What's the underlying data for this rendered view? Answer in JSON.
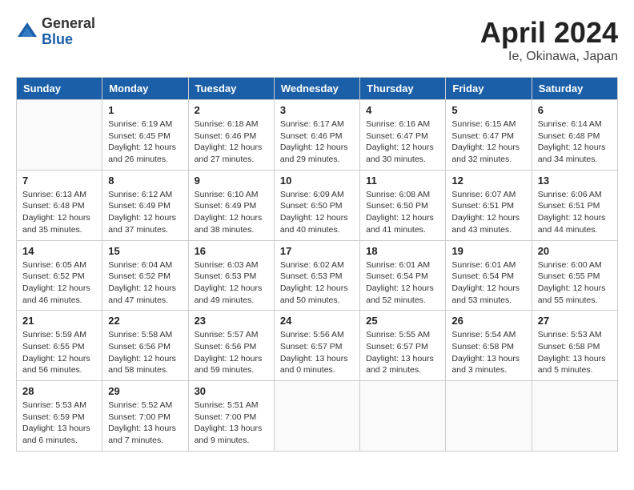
{
  "logo": {
    "general": "General",
    "blue": "Blue"
  },
  "title": "April 2024",
  "location": "Ie, Okinawa, Japan",
  "headers": [
    "Sunday",
    "Monday",
    "Tuesday",
    "Wednesday",
    "Thursday",
    "Friday",
    "Saturday"
  ],
  "weeks": [
    [
      {
        "day": "",
        "info": ""
      },
      {
        "day": "1",
        "info": "Sunrise: 6:19 AM\nSunset: 6:45 PM\nDaylight: 12 hours\nand 26 minutes."
      },
      {
        "day": "2",
        "info": "Sunrise: 6:18 AM\nSunset: 6:46 PM\nDaylight: 12 hours\nand 27 minutes."
      },
      {
        "day": "3",
        "info": "Sunrise: 6:17 AM\nSunset: 6:46 PM\nDaylight: 12 hours\nand 29 minutes."
      },
      {
        "day": "4",
        "info": "Sunrise: 6:16 AM\nSunset: 6:47 PM\nDaylight: 12 hours\nand 30 minutes."
      },
      {
        "day": "5",
        "info": "Sunrise: 6:15 AM\nSunset: 6:47 PM\nDaylight: 12 hours\nand 32 minutes."
      },
      {
        "day": "6",
        "info": "Sunrise: 6:14 AM\nSunset: 6:48 PM\nDaylight: 12 hours\nand 34 minutes."
      }
    ],
    [
      {
        "day": "7",
        "info": "Sunrise: 6:13 AM\nSunset: 6:48 PM\nDaylight: 12 hours\nand 35 minutes."
      },
      {
        "day": "8",
        "info": "Sunrise: 6:12 AM\nSunset: 6:49 PM\nDaylight: 12 hours\nand 37 minutes."
      },
      {
        "day": "9",
        "info": "Sunrise: 6:10 AM\nSunset: 6:49 PM\nDaylight: 12 hours\nand 38 minutes."
      },
      {
        "day": "10",
        "info": "Sunrise: 6:09 AM\nSunset: 6:50 PM\nDaylight: 12 hours\nand 40 minutes."
      },
      {
        "day": "11",
        "info": "Sunrise: 6:08 AM\nSunset: 6:50 PM\nDaylight: 12 hours\nand 41 minutes."
      },
      {
        "day": "12",
        "info": "Sunrise: 6:07 AM\nSunset: 6:51 PM\nDaylight: 12 hours\nand 43 minutes."
      },
      {
        "day": "13",
        "info": "Sunrise: 6:06 AM\nSunset: 6:51 PM\nDaylight: 12 hours\nand 44 minutes."
      }
    ],
    [
      {
        "day": "14",
        "info": "Sunrise: 6:05 AM\nSunset: 6:52 PM\nDaylight: 12 hours\nand 46 minutes."
      },
      {
        "day": "15",
        "info": "Sunrise: 6:04 AM\nSunset: 6:52 PM\nDaylight: 12 hours\nand 47 minutes."
      },
      {
        "day": "16",
        "info": "Sunrise: 6:03 AM\nSunset: 6:53 PM\nDaylight: 12 hours\nand 49 minutes."
      },
      {
        "day": "17",
        "info": "Sunrise: 6:02 AM\nSunset: 6:53 PM\nDaylight: 12 hours\nand 50 minutes."
      },
      {
        "day": "18",
        "info": "Sunrise: 6:01 AM\nSunset: 6:54 PM\nDaylight: 12 hours\nand 52 minutes."
      },
      {
        "day": "19",
        "info": "Sunrise: 6:01 AM\nSunset: 6:54 PM\nDaylight: 12 hours\nand 53 minutes."
      },
      {
        "day": "20",
        "info": "Sunrise: 6:00 AM\nSunset: 6:55 PM\nDaylight: 12 hours\nand 55 minutes."
      }
    ],
    [
      {
        "day": "21",
        "info": "Sunrise: 5:59 AM\nSunset: 6:55 PM\nDaylight: 12 hours\nand 56 minutes."
      },
      {
        "day": "22",
        "info": "Sunrise: 5:58 AM\nSunset: 6:56 PM\nDaylight: 12 hours\nand 58 minutes."
      },
      {
        "day": "23",
        "info": "Sunrise: 5:57 AM\nSunset: 6:56 PM\nDaylight: 12 hours\nand 59 minutes."
      },
      {
        "day": "24",
        "info": "Sunrise: 5:56 AM\nSunset: 6:57 PM\nDaylight: 13 hours\nand 0 minutes."
      },
      {
        "day": "25",
        "info": "Sunrise: 5:55 AM\nSunset: 6:57 PM\nDaylight: 13 hours\nand 2 minutes."
      },
      {
        "day": "26",
        "info": "Sunrise: 5:54 AM\nSunset: 6:58 PM\nDaylight: 13 hours\nand 3 minutes."
      },
      {
        "day": "27",
        "info": "Sunrise: 5:53 AM\nSunset: 6:58 PM\nDaylight: 13 hours\nand 5 minutes."
      }
    ],
    [
      {
        "day": "28",
        "info": "Sunrise: 5:53 AM\nSunset: 6:59 PM\nDaylight: 13 hours\nand 6 minutes."
      },
      {
        "day": "29",
        "info": "Sunrise: 5:52 AM\nSunset: 7:00 PM\nDaylight: 13 hours\nand 7 minutes."
      },
      {
        "day": "30",
        "info": "Sunrise: 5:51 AM\nSunset: 7:00 PM\nDaylight: 13 hours\nand 9 minutes."
      },
      {
        "day": "",
        "info": ""
      },
      {
        "day": "",
        "info": ""
      },
      {
        "day": "",
        "info": ""
      },
      {
        "day": "",
        "info": ""
      }
    ]
  ]
}
